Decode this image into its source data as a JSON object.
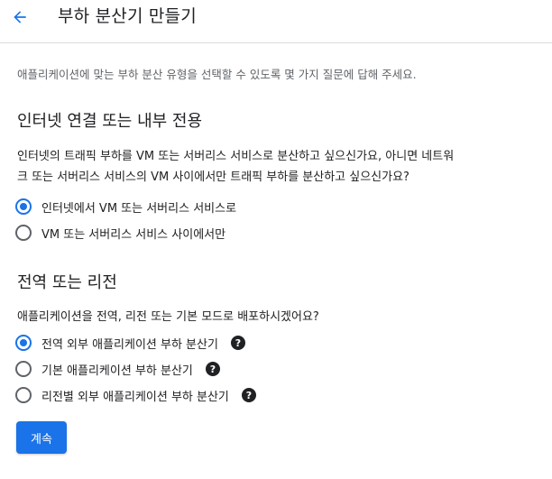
{
  "header": {
    "title": "부하 분산기 만들기",
    "back_icon": "arrow-back-icon"
  },
  "intro": "애플리케이션에 맞는 부하 분산 유형을 선택할 수 있도록 몇 가지 질문에 답해 주세요.",
  "section1": {
    "title": "인터넷 연결 또는 내부 전용",
    "question_line1": "인터넷의 트래픽 부하를 VM 또는 서버리스 서비스로 분산하고 싶으신가요, 아니면 네트워",
    "question_line2": "크 또는 서버리스 서비스의 VM 사이에서만 트래픽 부하를 분산하고 싶으신가요?",
    "options": [
      {
        "label": "인터넷에서 VM 또는 서버리스 서비스로",
        "selected": true
      },
      {
        "label": "VM 또는 서버리스 서비스 사이에서만",
        "selected": false
      }
    ]
  },
  "section2": {
    "title": "전역 또는 리전",
    "question": "애플리케이션을 전역, 리전 또는 기본 모드로 배포하시겠어요?",
    "options": [
      {
        "label": "전역 외부 애플리케이션 부하 분산기",
        "selected": true,
        "help_icon": "help-icon"
      },
      {
        "label": "기본 애플리케이션 부하 분산기",
        "selected": false,
        "help_icon": "help-icon"
      },
      {
        "label": "리전별 외부 애플리케이션 부하 분산기",
        "selected": false,
        "help_icon": "help-icon"
      }
    ]
  },
  "continue_label": "계속",
  "colors": {
    "accent": "#1a73e8",
    "text": "#202124",
    "secondary_text": "#5f6368",
    "divider": "#dadce0"
  }
}
